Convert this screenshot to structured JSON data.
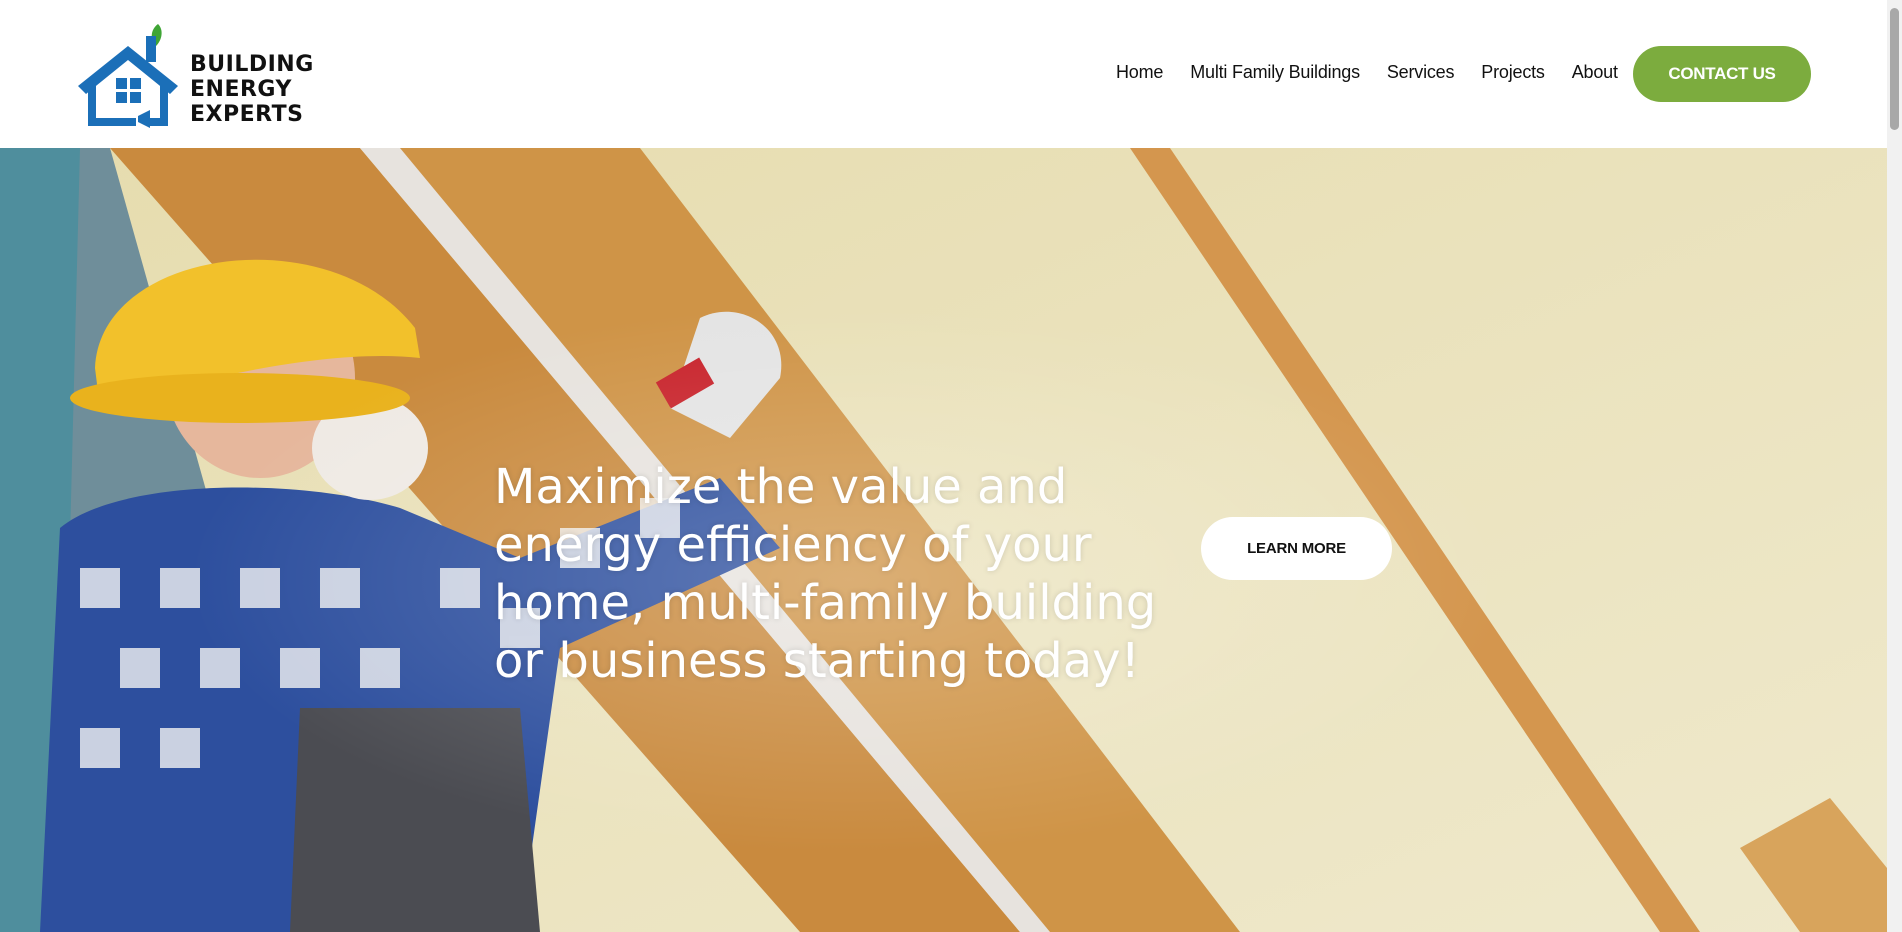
{
  "brand": {
    "lines": [
      "BUILDING",
      "ENERGY",
      "EXPERTS"
    ],
    "colors": {
      "blue": "#1b6fb8",
      "green": "#3fa535",
      "text": "#111111"
    }
  },
  "nav": {
    "items": [
      "Home",
      "Multi Family Buildings",
      "Services",
      "Projects",
      "About"
    ],
    "cta": "CONTACT US",
    "cta_color": "#7cac3e"
  },
  "hero": {
    "headline": "Maximize the value and energy efficiency of your home, multi-family building or business starting today!",
    "button": "LEARN MORE",
    "image_description_icon": "worker-installing-insulation-image"
  }
}
